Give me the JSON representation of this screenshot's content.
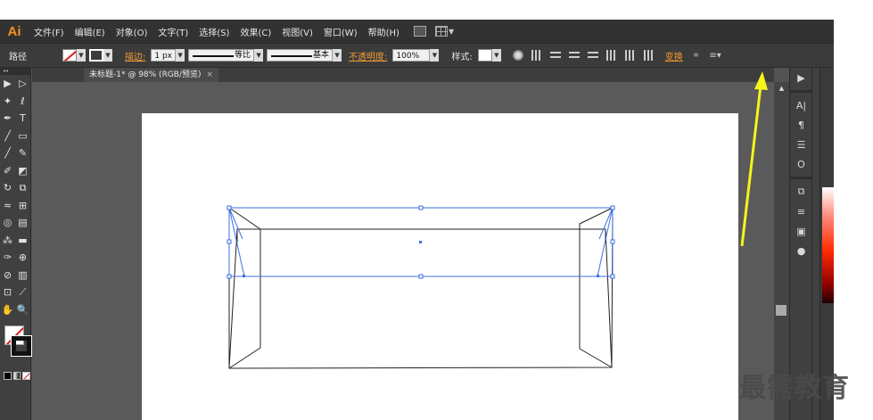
{
  "app": {
    "logo": "Ai",
    "menu": [
      "文件(F)",
      "编辑(E)",
      "对象(O)",
      "文字(T)",
      "选择(S)",
      "效果(C)",
      "视图(V)",
      "窗口(W)",
      "帮助(H)"
    ]
  },
  "control_bar": {
    "object_label": "路径",
    "stroke_label": "描边:",
    "stroke_weight": "1 px",
    "profile_label": "等比",
    "brush_label": "基本",
    "opacity_label": "不透明度:",
    "opacity_value": "100%",
    "style_label": "样式:",
    "transform_link": "变换"
  },
  "document": {
    "tab_title": "未标题-1* @ 98% (RGB/预览)",
    "close_glyph": "×"
  },
  "tools": [
    [
      "selection-tool",
      "direct-selection-tool"
    ],
    [
      "magic-wand-tool",
      "lasso-tool"
    ],
    [
      "pen-tool",
      "type-tool"
    ],
    [
      "line-tool",
      "rectangle-tool"
    ],
    [
      "paintbrush-tool",
      "pencil-tool"
    ],
    [
      "blob-brush-tool",
      "eraser-tool"
    ],
    [
      "rotate-tool",
      "scale-tool"
    ],
    [
      "warp-tool",
      "free-transform-tool"
    ],
    [
      "shape-builder-tool",
      "graph-tool"
    ],
    [
      "symbol-sprayer-tool",
      "gradient-tool"
    ],
    [
      "eyedropper-tool",
      "blend-tool"
    ],
    [
      "slice-tool",
      "column-graph-tool"
    ],
    [
      "artboard-tool",
      "knife-tool"
    ],
    [
      "hand-tool",
      "zoom-tool"
    ]
  ],
  "tool_glyphs": {
    "selection-tool": "▶",
    "direct-selection-tool": "▷",
    "magic-wand-tool": "✦",
    "lasso-tool": "ℓ",
    "pen-tool": "✒",
    "type-tool": "T",
    "line-tool": "╱",
    "rectangle-tool": "▭",
    "paintbrush-tool": "╱",
    "pencil-tool": "✎",
    "blob-brush-tool": "✐",
    "eraser-tool": "◩",
    "rotate-tool": "↻",
    "scale-tool": "⧉",
    "warp-tool": "≈",
    "free-transform-tool": "⊞",
    "shape-builder-tool": "◎",
    "graph-tool": "▤",
    "symbol-sprayer-tool": "⁂",
    "gradient-tool": "▬",
    "eyedropper-tool": "✑",
    "blend-tool": "⊕",
    "slice-tool": "⊘",
    "column-graph-tool": "▥",
    "artboard-tool": "⊡",
    "knife-tool": "⟋",
    "hand-tool": "✋",
    "zoom-tool": "🔍"
  },
  "dock": {
    "left_column": [
      "▶",
      "A|",
      "¶",
      "☰",
      "O",
      "⧉",
      "≡",
      "▣",
      "●"
    ],
    "right_column": [
      "◧",
      "☐",
      "⬚",
      "▦"
    ]
  },
  "watermark": "最需教育",
  "colors": {
    "accent_orange": "#f29a33",
    "selection_blue": "#3b6fe0",
    "arrow_yellow": "#f5f51a"
  }
}
